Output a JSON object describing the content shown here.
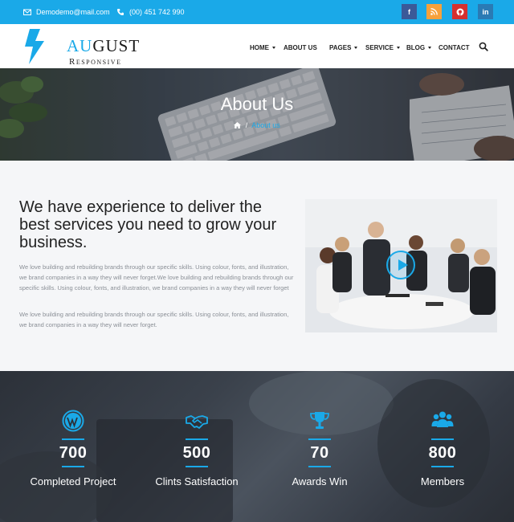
{
  "colors": {
    "accent": "#1aa9e8",
    "facebook": "#3b5998",
    "rss": "#f7a13b",
    "pinterest": "#d62f2f",
    "linkedin": "#2a7ab4"
  },
  "topbar": {
    "email_icon": "envelope-icon",
    "email": "Demodemo@mail.com",
    "phone_icon": "phone-icon",
    "phone": "(00) 451 742 990",
    "social": [
      {
        "name": "facebook",
        "glyph": "f"
      },
      {
        "name": "rss",
        "glyph": "◉"
      },
      {
        "name": "pinterest",
        "glyph": "P"
      },
      {
        "name": "linkedin",
        "glyph": "in"
      }
    ]
  },
  "logo": {
    "big_prefix": "Au",
    "big_rest": "gust",
    "small": "Responsive"
  },
  "nav": {
    "items": [
      {
        "label": "HOME",
        "dropdown": true
      },
      {
        "label": "ABOUT US",
        "dropdown": false
      },
      {
        "label": "PAGES",
        "dropdown": true
      },
      {
        "label": "SERVICE",
        "dropdown": true
      },
      {
        "label": "BLOG",
        "dropdown": true
      },
      {
        "label": "CONTACT",
        "dropdown": false
      }
    ],
    "search_icon": "search-icon"
  },
  "hero": {
    "title": "About Us",
    "home_icon": "home-icon",
    "separator": "/",
    "current": "About us"
  },
  "about": {
    "heading": "We have experience to deliver the best services you need to grow your business.",
    "para1": "We love building and rebuilding brands through our specific skills. Using colour, fonts, and illustration, we brand companies in a way they will never forget.We love building and rebuilding brands through our specific skills. Using colour, fonts, and illustration, we brand companies in a way they will never forget",
    "para2": "We love building and rebuilding brands through our specific skills. Using colour, fonts, and illustration, we brand companies in a way they will never forget.",
    "play_icon": "play-icon"
  },
  "stats": [
    {
      "icon": "wordpress-icon",
      "value": "700",
      "label": "Completed Project"
    },
    {
      "icon": "handshake-icon",
      "value": "500",
      "label": "Clints Satisfaction"
    },
    {
      "icon": "trophy-icon",
      "value": "70",
      "label": "Awards Win"
    },
    {
      "icon": "users-icon",
      "value": "800",
      "label": "Members"
    }
  ]
}
